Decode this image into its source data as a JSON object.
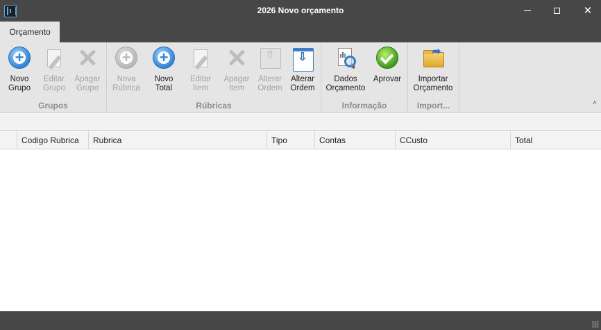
{
  "window": {
    "title": "2026 Novo orçamento",
    "icon": "app-bracket-icon",
    "controls": {
      "minimize": "minimize-icon",
      "maximize": "maximize-icon",
      "close": "✕"
    }
  },
  "tabs": [
    {
      "label": "Orçamento",
      "active": true
    }
  ],
  "ribbon": {
    "groups": {
      "grupos": {
        "label": "Grupos",
        "buttons": {
          "novo_grupo": {
            "line1": "Novo",
            "line2": "Grupo",
            "enabled": true,
            "icon": "add-icon"
          },
          "editar_grupo": {
            "line1": "Editar",
            "line2": "Grupo",
            "enabled": false,
            "icon": "edit-icon"
          },
          "apagar_grupo": {
            "line1": "Apagar",
            "line2": "Grupo",
            "enabled": false,
            "icon": "delete-icon"
          }
        }
      },
      "rubricas": {
        "label": "Rúbricas",
        "buttons": {
          "nova_rubrica": {
            "line1": "Nova",
            "line2": "Rúbrica",
            "enabled": false,
            "icon": "add-icon"
          },
          "novo_total": {
            "line1": "Novo",
            "line2": "Total",
            "enabled": true,
            "icon": "add-icon"
          },
          "editar_item": {
            "line1": "Editar",
            "line2": "Item",
            "enabled": false,
            "icon": "edit-icon"
          },
          "apagar_item": {
            "line1": "Apagar",
            "line2": "Item",
            "enabled": false,
            "icon": "delete-icon"
          },
          "alterar_ordem_up": {
            "line1": "Alterar",
            "line2": "Ordem",
            "enabled": false,
            "icon": "move-up-icon"
          },
          "alterar_ordem_down": {
            "line1": "Alterar",
            "line2": "Ordem",
            "enabled": true,
            "icon": "move-down-icon"
          }
        }
      },
      "informacao": {
        "label": "Informação",
        "buttons": {
          "dados_orcamento": {
            "line1": "Dados",
            "line2": "Orçamento",
            "enabled": true,
            "icon": "report-search-icon"
          },
          "aprovar": {
            "line1": "Aprovar",
            "line2": "",
            "enabled": true,
            "icon": "check-icon"
          }
        }
      },
      "importar": {
        "label": "Import...",
        "buttons": {
          "importar_orcamento": {
            "line1": "Importar",
            "line2": "Orçamento",
            "enabled": true,
            "icon": "folder-open-icon"
          }
        }
      }
    },
    "collapse_glyph": "˄"
  },
  "grid": {
    "columns": [
      "",
      "Codigo Rubrica",
      "Rubrica",
      "Tipo",
      "Contas",
      "CCusto",
      "Total"
    ],
    "rows": []
  },
  "colors": {
    "chrome": "#474747",
    "ribbon": "#e5e5e5",
    "accent_blue": "#2f86d8",
    "approve_green": "#3e9a1c",
    "disabled_text": "#a3a3a3"
  }
}
